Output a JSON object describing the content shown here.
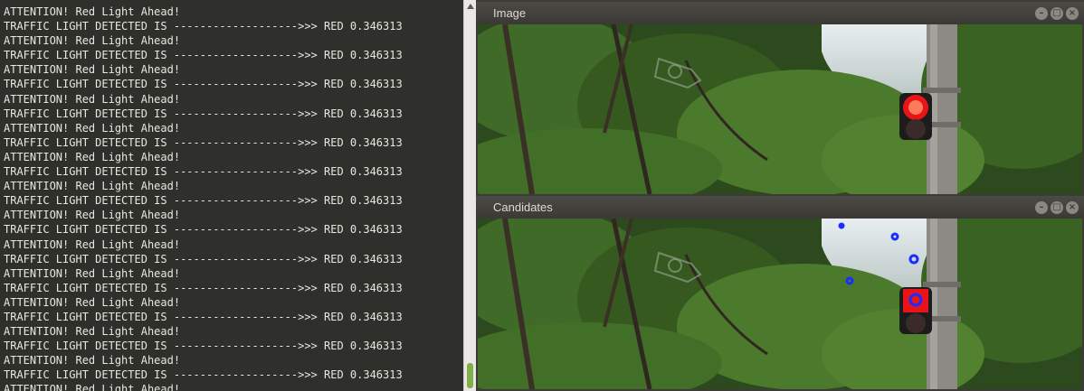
{
  "terminal": {
    "lines": [
      "ATTENTION! Red Light Ahead!",
      "TRAFFIC LIGHT DETECTED IS ------------------->>> RED 0.346313",
      "ATTENTION! Red Light Ahead!",
      "TRAFFIC LIGHT DETECTED IS ------------------->>> RED 0.346313",
      "ATTENTION! Red Light Ahead!",
      "TRAFFIC LIGHT DETECTED IS ------------------->>> RED 0.346313",
      "ATTENTION! Red Light Ahead!",
      "TRAFFIC LIGHT DETECTED IS ------------------->>> RED 0.346313",
      "ATTENTION! Red Light Ahead!",
      "TRAFFIC LIGHT DETECTED IS ------------------->>> RED 0.346313",
      "ATTENTION! Red Light Ahead!",
      "TRAFFIC LIGHT DETECTED IS ------------------->>> RED 0.346313",
      "ATTENTION! Red Light Ahead!",
      "TRAFFIC LIGHT DETECTED IS ------------------->>> RED 0.346313",
      "ATTENTION! Red Light Ahead!",
      "TRAFFIC LIGHT DETECTED IS ------------------->>> RED 0.346313",
      "ATTENTION! Red Light Ahead!",
      "TRAFFIC LIGHT DETECTED IS ------------------->>> RED 0.346313",
      "ATTENTION! Red Light Ahead!",
      "TRAFFIC LIGHT DETECTED IS ------------------->>> RED 0.346313",
      "ATTENTION! Red Light Ahead!",
      "TRAFFIC LIGHT DETECTED IS ------------------->>> RED 0.346313",
      "ATTENTION! Red Light Ahead!",
      "TRAFFIC LIGHT DETECTED IS ------------------->>> RED 0.346313",
      "ATTENTION! Red Light Ahead!",
      "TRAFFIC LIGHT DETECTED IS ------------------->>> RED 0.346313",
      "ATTENTION! Red Light Ahead!"
    ]
  },
  "windows": {
    "image": {
      "title": "Image"
    },
    "candidates": {
      "title": "Candidates"
    }
  },
  "icons": {
    "minimize": "minimize-icon",
    "maximize": "maximize-icon",
    "close": "close-icon"
  },
  "colors": {
    "terminal_bg": "#2f2f2b",
    "terminal_text": "#e8e8e0",
    "titlebar": "#3c3b37",
    "light_red": "#e8141a",
    "candidate_blue": "#1a2cff"
  }
}
